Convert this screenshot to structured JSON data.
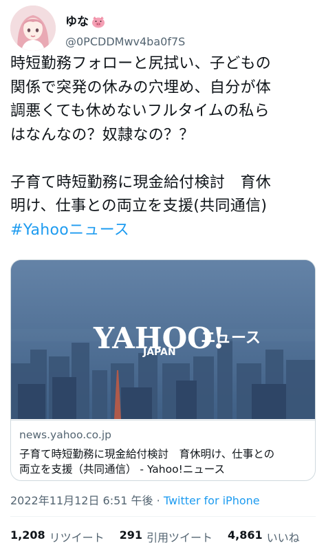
{
  "user": {
    "name": "ゆな",
    "name_emoji": "pig-face",
    "handle": "@0PCDDMwv4ba0f7S"
  },
  "tweet": {
    "lines": [
      "時短勤務フォローと尻拭い、子どもの",
      "関係で突発の休みの穴埋め、自分が体",
      "調悪くても休めないフルタイムの私ら",
      "はなんなの？奴隷なの？？"
    ],
    "link_lines": [
      "子育て時短勤務に現金給付検討　育休",
      "明け、仕事との両立を支援(共同通信)"
    ],
    "hashtag": "#Yahooニュース"
  },
  "card": {
    "image": {
      "logo_text": "YAHOO!",
      "logo_sub": "JAPAN",
      "logo_suffix": "ニュース"
    },
    "domain": "news.yahoo.co.jp",
    "title_lines": [
      "子育て時短勤務に現金給付検討　育休明け、仕事との",
      "両立を支援（共同通信） - Yahoo!ニュース"
    ]
  },
  "meta": {
    "timestamp": "2022年11月12日 6:51 午後",
    "separator": " · ",
    "source": "Twitter for iPhone"
  },
  "stats": {
    "retweets_count": "1,208",
    "retweets_label": "リツイート",
    "quotes_count": "291",
    "quotes_label": "引用ツイート",
    "likes_count": "4,861",
    "likes_label": "いいね"
  },
  "colors": {
    "link": "#1d9bf0",
    "secondary": "#536471",
    "card_sky": "#4d6e93"
  }
}
